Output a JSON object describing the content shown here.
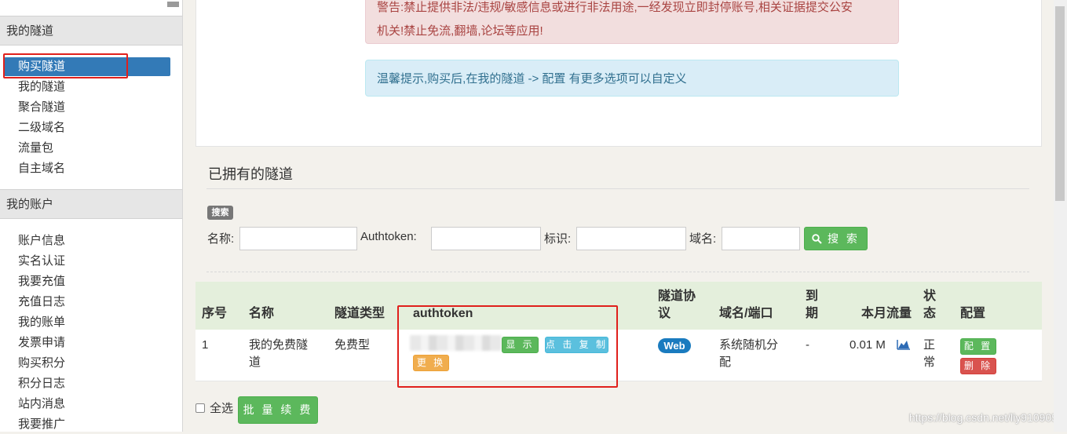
{
  "sidebar": {
    "section1_title": "我的隧道",
    "section1_items": [
      "购买隧道",
      "我的隧道",
      "聚合隧道",
      "二级域名",
      "流量包",
      "自主域名"
    ],
    "section2_title": "我的账户",
    "section2_items": [
      "账户信息",
      "实名认证",
      "我要充值",
      "充值日志",
      "我的账单",
      "发票申请",
      "购买积分",
      "积分日志",
      "站内消息",
      "我要推广"
    ]
  },
  "alerts": {
    "danger_line1": "警告:禁止提供非法/违规/敏感信息或进行非法用途,一经发现立即封停账号,相关证据提交公安",
    "danger_line2": "机关!禁止免流,翻墙,论坛等应用!",
    "info": "温馨提示,购买后,在我的隧道 -> 配置 有更多选项可以自定义"
  },
  "tunnels": {
    "section_title": "已拥有的隧道",
    "search_badge": "搜索",
    "filters": {
      "name_label": "名称:",
      "authtoken_label": "Authtoken:",
      "tag_label": "标识:",
      "domain_label": "域名:",
      "search_button": "搜 索"
    },
    "headers": {
      "index": "序号",
      "name": "名称",
      "type": "隧道类型",
      "authtoken": "authtoken",
      "protocol_1": "隧道协",
      "protocol_2": "议",
      "domain_port": "域名/端口",
      "expire_1": "到",
      "expire_2": "期",
      "traffic": "本月流量",
      "status_1": "状",
      "status_2": "态",
      "config": "配置"
    },
    "rows": [
      {
        "index": "1",
        "name_1": "我的免费隧",
        "name_2": "道",
        "type": "免费型",
        "show_button": "显 示",
        "copy_button": "点 击 复 制",
        "replace_button": "更 换",
        "protocol": "Web",
        "domain_1": "系统随机分",
        "domain_2": "配",
        "expire": "-",
        "traffic": "0.01 M",
        "status_1": "正",
        "status_2": "常",
        "config_button": "配 置",
        "delete_button": "删 除"
      }
    ],
    "select_all_label": "全选",
    "batch_renew_button": "批 量 续 费"
  },
  "watermark": "https://blog.csdn.net/liy910905",
  "icons": {
    "search": "magnifier-icon",
    "traffic": "area-chart-icon"
  },
  "colors": {
    "active_sidebar": "#337ab7",
    "success": "#5cb85c",
    "info": "#5bc0de",
    "warning": "#f0ad4e",
    "danger": "#d9534f",
    "highlight_box": "#e0201c"
  }
}
